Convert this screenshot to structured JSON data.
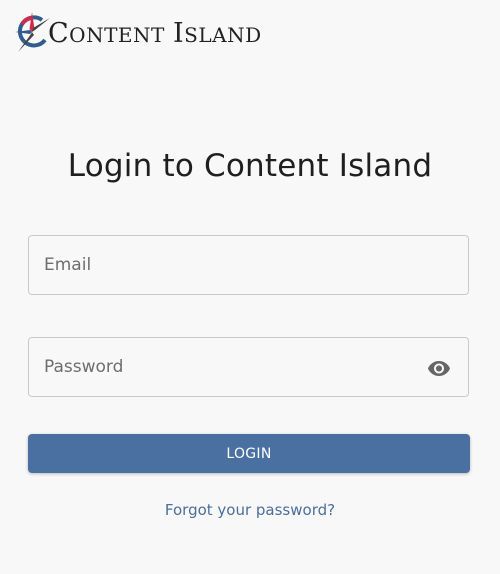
{
  "brand": {
    "logo_icon": "compass-star-logo-icon",
    "name_first_letter_1": "C",
    "name_rest_1": "ONTENT",
    "name_first_letter_2": "I",
    "name_rest_2": "SLAND"
  },
  "login": {
    "title": "Login to Content Island",
    "email_placeholder": "Email",
    "password_placeholder": "Password",
    "password_toggle_icon": "eye-icon",
    "submit_label": "LOGIN",
    "forgot_link": "Forgot your password?"
  },
  "colors": {
    "primary": "#4a70a2",
    "link": "#4a6f98",
    "background": "#f8f8f9",
    "logo_red": "#d22b4a",
    "logo_blue": "#2f5d8f"
  }
}
